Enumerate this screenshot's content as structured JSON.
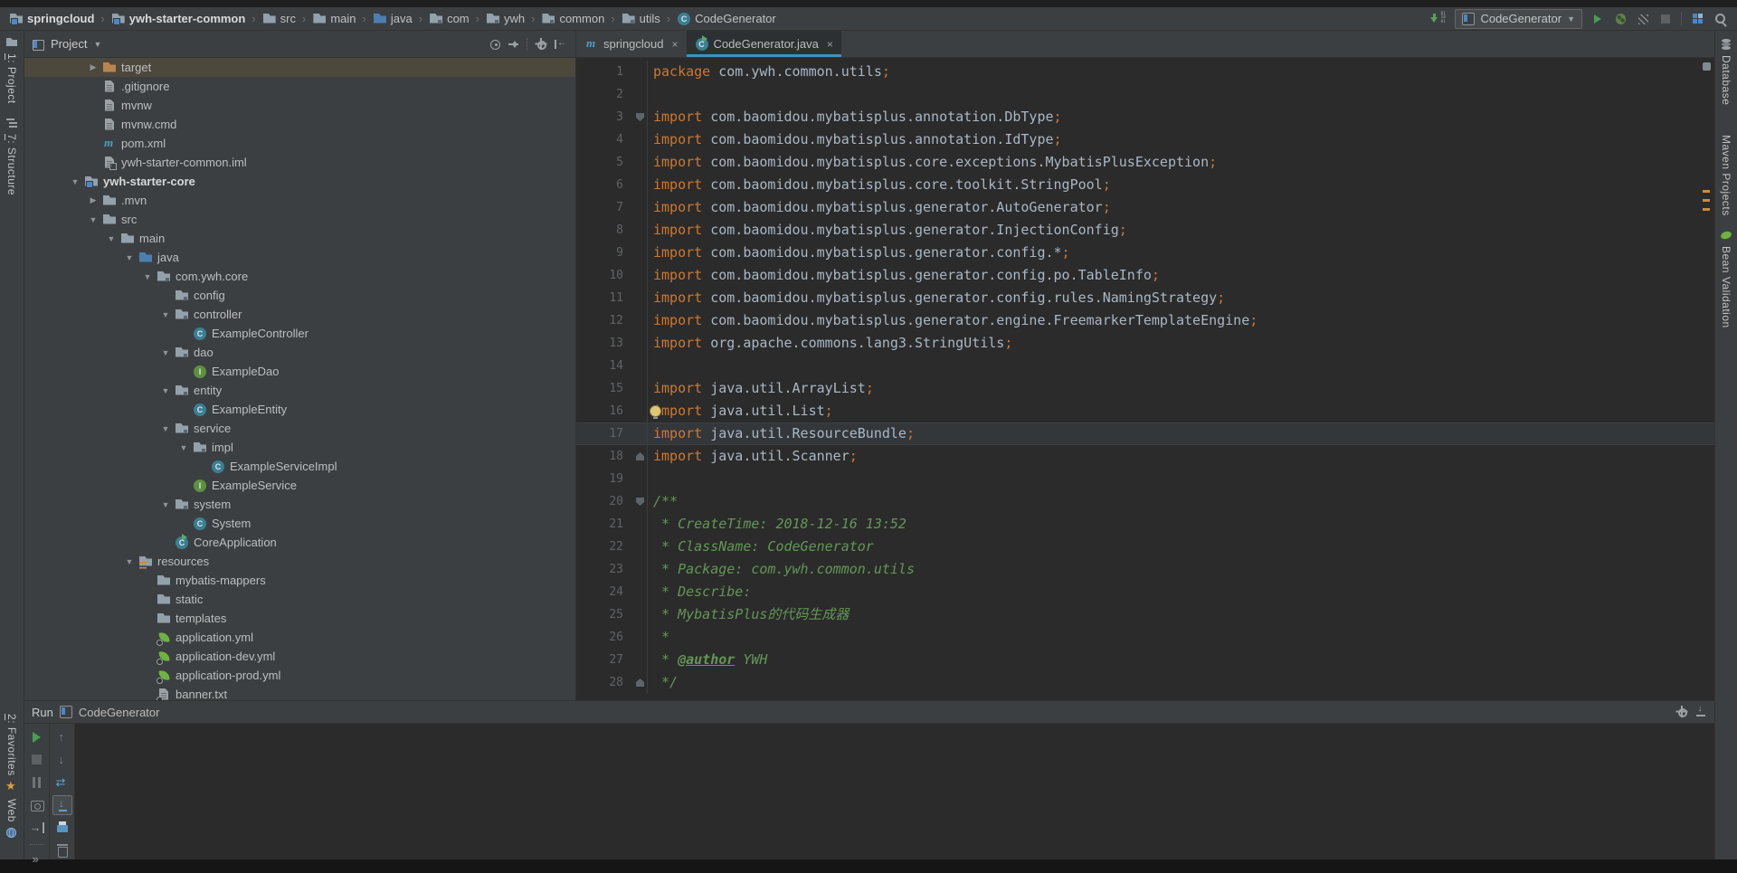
{
  "colors": {
    "panel": "#3c3f41",
    "editor_bg": "#2b2b2b",
    "keyword": "#cc7832",
    "plain_code": "#a9b7c6",
    "comment": "#629755",
    "line_number": "#606366",
    "selection_row": "#4d483c",
    "tab_underline": "#4093b8",
    "run_green": "#499C54",
    "error_stripe": "#cf8a3f",
    "spring_green": "#6db33f"
  },
  "toolbar": {
    "breadcrumbs": [
      {
        "label": "springcloud",
        "icon": "module",
        "bold": true
      },
      {
        "label": "ywh-starter-common",
        "icon": "module",
        "bold": true
      },
      {
        "label": "src",
        "icon": "folder"
      },
      {
        "label": "main",
        "icon": "folder"
      },
      {
        "label": "java",
        "icon": "folder-src"
      },
      {
        "label": "com",
        "icon": "package"
      },
      {
        "label": "ywh",
        "icon": "package"
      },
      {
        "label": "common",
        "icon": "package"
      },
      {
        "label": "utils",
        "icon": "package"
      },
      {
        "label": "CodeGenerator",
        "icon": "class"
      }
    ],
    "run_config": "CodeGenerator",
    "icons": [
      "update-project-icon",
      "run-config-app-icon",
      "run-icon",
      "debug-icon",
      "coverage-icon",
      "stop-icon",
      "project-structure-icon",
      "search-icon"
    ]
  },
  "project_panel": {
    "title": "Project",
    "header_icons": [
      "locate-icon",
      "collapse-all-icon",
      "gear-icon",
      "hide-panel-icon"
    ]
  },
  "tabs": [
    {
      "label": "springcloud",
      "icon": "maven",
      "active": false
    },
    {
      "label": "CodeGenerator.java",
      "icon": "class-run",
      "active": true
    }
  ],
  "tree": [
    {
      "label": "target",
      "depth": 2,
      "arrow": "closed",
      "icon": "folder-excluded",
      "selected": true
    },
    {
      "label": ".gitignore",
      "depth": 2,
      "icon": "file"
    },
    {
      "label": "mvnw",
      "depth": 2,
      "icon": "file"
    },
    {
      "label": "mvnw.cmd",
      "depth": 2,
      "icon": "file"
    },
    {
      "label": "pom.xml",
      "depth": 2,
      "icon": "maven"
    },
    {
      "label": "ywh-starter-common.iml",
      "depth": 2,
      "icon": "iml"
    },
    {
      "label": "ywh-starter-core",
      "depth": 1,
      "arrow": "open",
      "icon": "module",
      "bold": true
    },
    {
      "label": ".mvn",
      "depth": 2,
      "arrow": "closed",
      "icon": "folder"
    },
    {
      "label": "src",
      "depth": 2,
      "arrow": "open",
      "icon": "folder"
    },
    {
      "label": "main",
      "depth": 3,
      "arrow": "open",
      "icon": "folder"
    },
    {
      "label": "java",
      "depth": 4,
      "arrow": "open",
      "icon": "folder-src"
    },
    {
      "label": "com.ywh.core",
      "depth": 5,
      "arrow": "open",
      "icon": "package"
    },
    {
      "label": "config",
      "depth": 6,
      "icon": "package"
    },
    {
      "label": "controller",
      "depth": 6,
      "arrow": "open",
      "icon": "package"
    },
    {
      "label": "ExampleController",
      "depth": 7,
      "icon": "class"
    },
    {
      "label": "dao",
      "depth": 6,
      "arrow": "open",
      "icon": "package"
    },
    {
      "label": "ExampleDao",
      "depth": 7,
      "icon": "interface"
    },
    {
      "label": "entity",
      "depth": 6,
      "arrow": "open",
      "icon": "package"
    },
    {
      "label": "ExampleEntity",
      "depth": 7,
      "icon": "class"
    },
    {
      "label": "service",
      "depth": 6,
      "arrow": "open",
      "icon": "package"
    },
    {
      "label": "impl",
      "depth": 7,
      "arrow": "open",
      "icon": "package"
    },
    {
      "label": "ExampleServiceImpl",
      "depth": 8,
      "icon": "class"
    },
    {
      "label": "ExampleService",
      "depth": 7,
      "icon": "interface"
    },
    {
      "label": "system",
      "depth": 6,
      "arrow": "open",
      "icon": "package"
    },
    {
      "label": "System",
      "depth": 7,
      "icon": "class"
    },
    {
      "label": "CoreApplication",
      "depth": 6,
      "icon": "class-run"
    },
    {
      "label": "resources",
      "depth": 4,
      "arrow": "open",
      "icon": "folder-res"
    },
    {
      "label": "mybatis-mappers",
      "depth": 5,
      "icon": "folder"
    },
    {
      "label": "static",
      "depth": 5,
      "icon": "folder"
    },
    {
      "label": "templates",
      "depth": 5,
      "icon": "folder"
    },
    {
      "label": "application.yml",
      "depth": 5,
      "icon": "spring"
    },
    {
      "label": "application-dev.yml",
      "depth": 5,
      "icon": "spring"
    },
    {
      "label": "application-prod.yml",
      "depth": 5,
      "icon": "spring"
    },
    {
      "label": "banner.txt",
      "depth": 5,
      "icon": "file-clock"
    }
  ],
  "editor": {
    "lines": [
      {
        "n": 1,
        "t": [
          [
            "k",
            "package"
          ],
          [
            "p",
            " com.ywh.common.utils"
          ],
          [
            "s",
            ";"
          ]
        ]
      },
      {
        "n": 2,
        "t": []
      },
      {
        "n": 3,
        "fold": "down",
        "t": [
          [
            "k",
            "import"
          ],
          [
            "p",
            " com.baomidou.mybatisplus.annotation.DbType"
          ],
          [
            "s",
            ";"
          ]
        ]
      },
      {
        "n": 4,
        "t": [
          [
            "k",
            "import"
          ],
          [
            "p",
            " com.baomidou.mybatisplus.annotation.IdType"
          ],
          [
            "s",
            ";"
          ]
        ]
      },
      {
        "n": 5,
        "t": [
          [
            "k",
            "import"
          ],
          [
            "p",
            " com.baomidou.mybatisplus.core.exceptions.MybatisPlusException"
          ],
          [
            "s",
            ";"
          ]
        ]
      },
      {
        "n": 6,
        "t": [
          [
            "k",
            "import"
          ],
          [
            "p",
            " com.baomidou.mybatisplus.core.toolkit.StringPool"
          ],
          [
            "s",
            ";"
          ]
        ]
      },
      {
        "n": 7,
        "t": [
          [
            "k",
            "import"
          ],
          [
            "p",
            " com.baomidou.mybatisplus.generator.AutoGenerator"
          ],
          [
            "s",
            ";"
          ]
        ]
      },
      {
        "n": 8,
        "t": [
          [
            "k",
            "import"
          ],
          [
            "p",
            " com.baomidou.mybatisplus.generator.InjectionConfig"
          ],
          [
            "s",
            ";"
          ]
        ]
      },
      {
        "n": 9,
        "t": [
          [
            "k",
            "import"
          ],
          [
            "p",
            " com.baomidou.mybatisplus.generator.config.*"
          ],
          [
            "s",
            ";"
          ]
        ]
      },
      {
        "n": 10,
        "t": [
          [
            "k",
            "import"
          ],
          [
            "p",
            " com.baomidou.mybatisplus.generator.config.po.TableInfo"
          ],
          [
            "s",
            ";"
          ]
        ]
      },
      {
        "n": 11,
        "t": [
          [
            "k",
            "import"
          ],
          [
            "p",
            " com.baomidou.mybatisplus.generator.config.rules.NamingStrategy"
          ],
          [
            "s",
            ";"
          ]
        ]
      },
      {
        "n": 12,
        "t": [
          [
            "k",
            "import"
          ],
          [
            "p",
            " com.baomidou.mybatisplus.generator.engine.FreemarkerTemplateEngine"
          ],
          [
            "s",
            ";"
          ]
        ]
      },
      {
        "n": 13,
        "t": [
          [
            "k",
            "import"
          ],
          [
            "p",
            " org.apache.commons.lang3.StringUtils"
          ],
          [
            "s",
            ";"
          ]
        ]
      },
      {
        "n": 14,
        "t": []
      },
      {
        "n": 15,
        "t": [
          [
            "k",
            "import"
          ],
          [
            "p",
            " java.util.ArrayList"
          ],
          [
            "s",
            ";"
          ]
        ]
      },
      {
        "n": 16,
        "bulb": true,
        "t": [
          [
            "k",
            "import"
          ],
          [
            "p",
            " java.util.List"
          ],
          [
            "s",
            ";"
          ]
        ]
      },
      {
        "n": 17,
        "current": true,
        "t": [
          [
            "k",
            "import"
          ],
          [
            "p",
            " java.util.ResourceBundle"
          ],
          [
            "s",
            ";"
          ]
        ]
      },
      {
        "n": 18,
        "fold": "up",
        "t": [
          [
            "k",
            "import"
          ],
          [
            "p",
            " java.util.Scanner"
          ],
          [
            "s",
            ";"
          ]
        ]
      },
      {
        "n": 19,
        "t": []
      },
      {
        "n": 20,
        "fold": "down",
        "t": [
          [
            "c",
            "/**"
          ]
        ]
      },
      {
        "n": 21,
        "t": [
          [
            "c",
            " * CreateTime: 2018-12-16 13:52"
          ]
        ]
      },
      {
        "n": 22,
        "t": [
          [
            "c",
            " * ClassName: CodeGenerator"
          ]
        ]
      },
      {
        "n": 23,
        "t": [
          [
            "c",
            " * Package: com.ywh.common.utils"
          ]
        ]
      },
      {
        "n": 24,
        "t": [
          [
            "c",
            " * Describe:"
          ]
        ]
      },
      {
        "n": 25,
        "t": [
          [
            "c",
            " * MybatisPlus的代码生成器"
          ]
        ]
      },
      {
        "n": 26,
        "t": [
          [
            "c",
            " *"
          ]
        ]
      },
      {
        "n": 27,
        "t": [
          [
            "c",
            " * "
          ],
          [
            "ct",
            "@author"
          ],
          [
            "c",
            " YWH"
          ]
        ]
      },
      {
        "n": 28,
        "fold": "up",
        "t": [
          [
            "c",
            " */"
          ]
        ]
      }
    ]
  },
  "run_panel": {
    "label": "Run",
    "config": "CodeGenerator",
    "toolbar_left": [
      "rerun-icon",
      "stop-icon",
      "pause-icon",
      "thread-dump-icon",
      "exit-icon",
      "more-icon"
    ],
    "toolbar_console": [
      "up-stack-icon",
      "down-stack-icon",
      "soft-wrap-icon",
      "scroll-to-end-icon",
      "print-icon",
      "clear-all-icon"
    ]
  },
  "left_strip": {
    "top": [
      {
        "label": "1: Project",
        "icon": "project"
      },
      {
        "label": "7: Structure",
        "icon": "structure"
      }
    ],
    "bottom": [
      {
        "label": "2: Favorites",
        "icon": "star"
      },
      {
        "label": "Web",
        "icon": "globe"
      }
    ]
  },
  "right_strip": {
    "top": [
      {
        "label": "Database",
        "icon": "database"
      },
      {
        "label": "Maven Projects",
        "icon": "maven-o"
      },
      {
        "label": "Bean Validation",
        "icon": "bean"
      }
    ]
  }
}
